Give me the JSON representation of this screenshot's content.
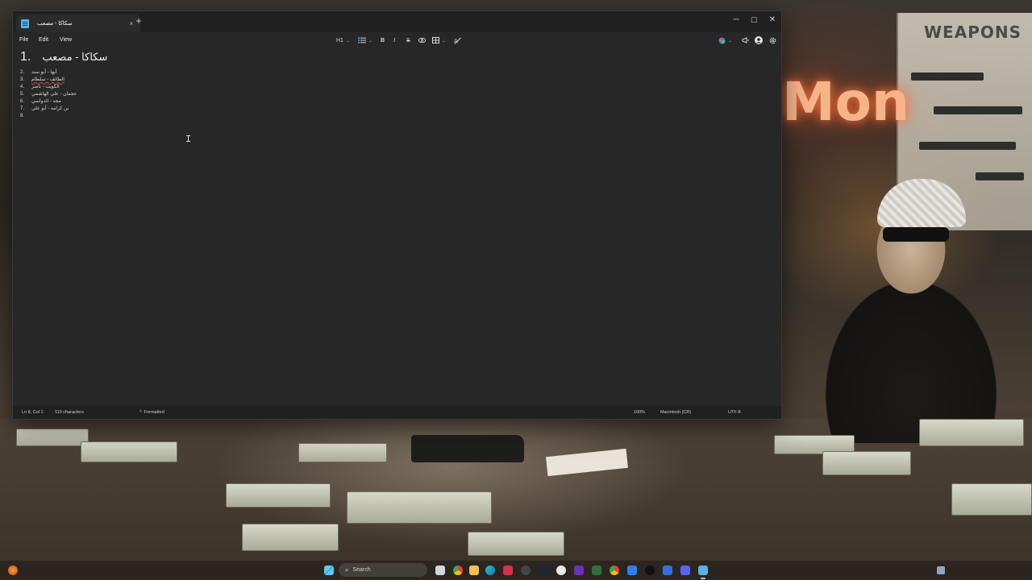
{
  "window": {
    "tab_title": "سكاكا - مصعب",
    "tab_close": "×",
    "new_tab": "+",
    "minimize": "─",
    "maximize": "☐",
    "close": "✕"
  },
  "menu": {
    "file": "File",
    "edit": "Edit",
    "view": "View"
  },
  "toolbar": {
    "heading": "H1",
    "list_icon": "list-icon",
    "bold": "B",
    "italic": "I",
    "strikethrough": "S",
    "link_icon": "link-icon",
    "table_icon": "table-icon",
    "clear_format_icon": "clear-formatting-icon",
    "copilot_icon": "copilot-icon",
    "whatsnew_icon": "megaphone-icon",
    "account_icon": "account-icon",
    "settings_icon": "gear-icon"
  },
  "document": {
    "heading": {
      "number": "1.",
      "text": "سكاكا - مصعب"
    },
    "items": [
      {
        "number": "2.",
        "text": "أبها - أبو سند",
        "spell": false
      },
      {
        "number": "3.",
        "text": "الطائف - سلطام",
        "spell": true
      },
      {
        "number": "4.",
        "text": "الكويت - ناصر",
        "spell": false
      },
      {
        "number": "5.",
        "text": "عجمان - علي الهاشمي",
        "spell": false
      },
      {
        "number": "6.",
        "text": "مجه - الدواسي",
        "spell": false
      },
      {
        "number": "7.",
        "text": "بن كرامه - أبو علي",
        "spell": false
      },
      {
        "number": "8.",
        "text": "",
        "spell": false
      }
    ]
  },
  "status": {
    "position": "Ln 8, Col 1",
    "characters": "110 characters",
    "format": "Formatted",
    "zoom": "100%",
    "line_endings": "Macintosh (CR)",
    "encoding": "UTF-8"
  },
  "wallpaper": {
    "poster_title": "WEAPONS",
    "neon": "Mon"
  },
  "taskbar": {
    "search_placeholder": "Search"
  },
  "colors": {
    "window_bg": "#272727",
    "titlebar_bg": "#202020",
    "accent": "#5ab1e8"
  }
}
